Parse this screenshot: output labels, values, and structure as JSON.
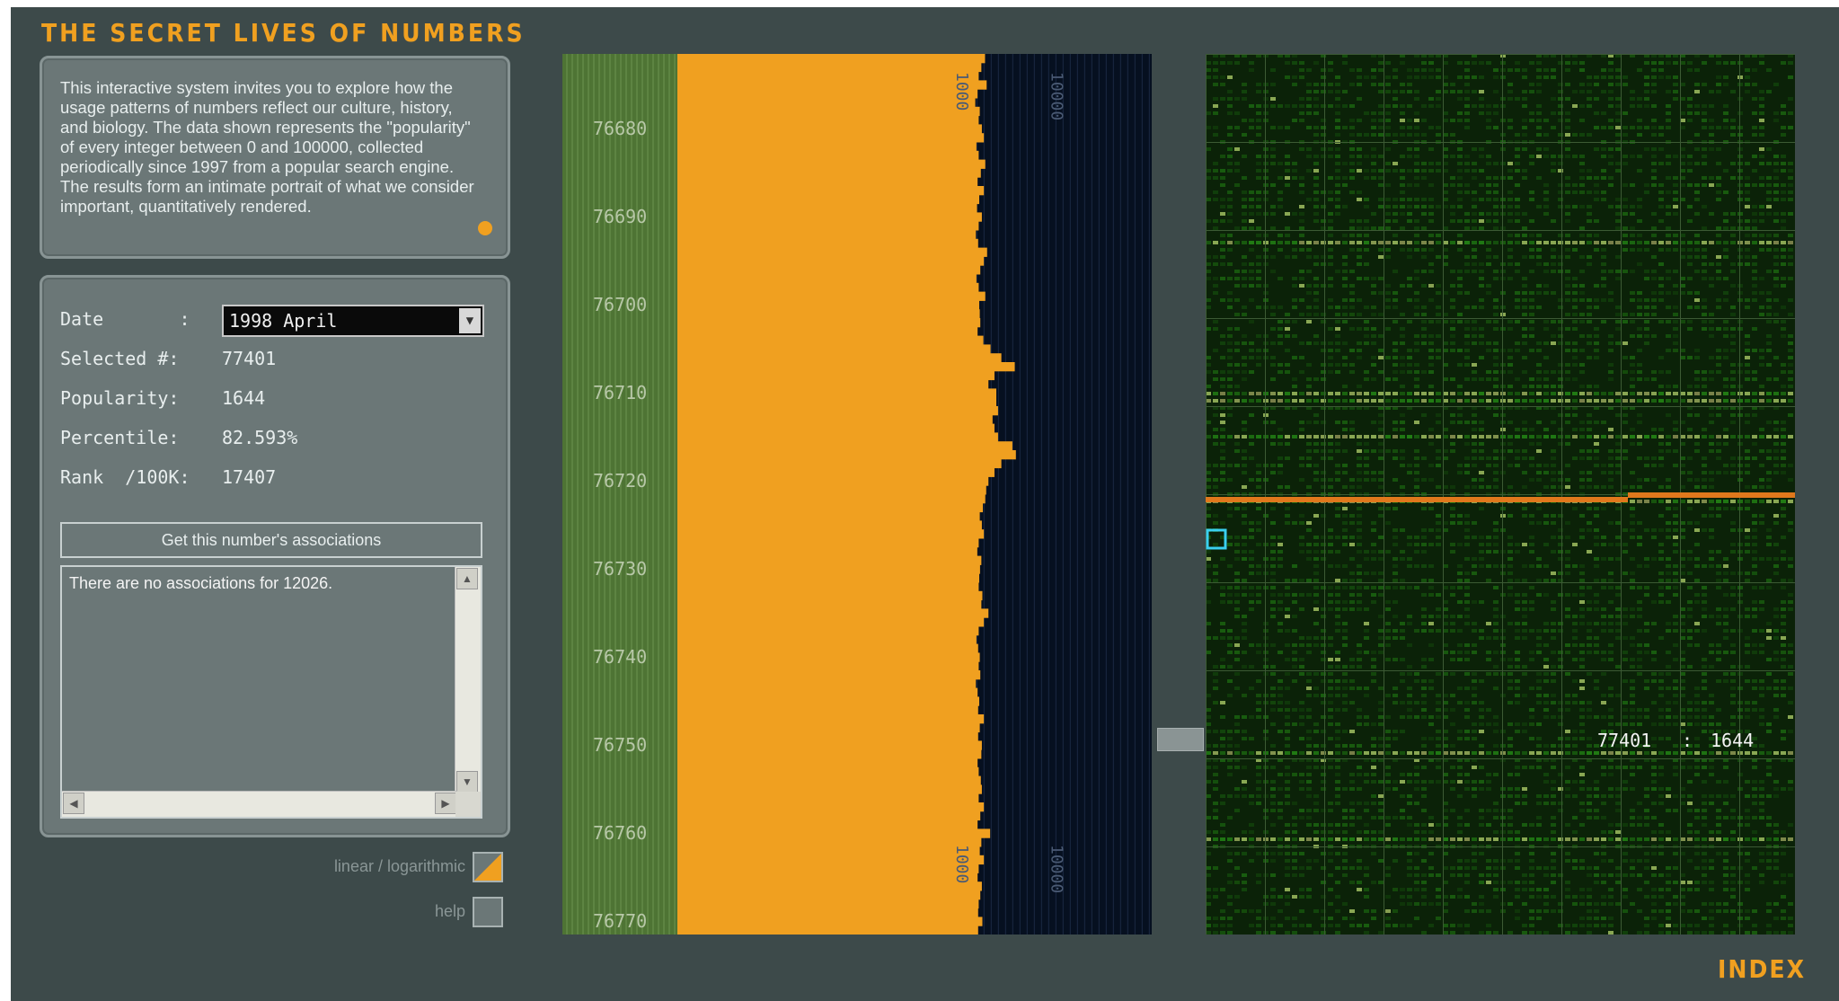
{
  "app": {
    "title": "THE SECRET LIVES OF NUMBERS",
    "index_label": "INDEX",
    "accent_color": "#f0a020"
  },
  "intro": {
    "text": "This interactive system invites you to explore how the usage patterns of numbers reflect our culture, history, and biology. The data shown represents the \"popularity\" of every integer between 0 and 100000, collected periodically since 1997 from a popular search engine. The results form an intimate portrait of what we consider important, quantitatively rendered."
  },
  "info": {
    "date_label": "Date       :",
    "date_value": "1998 April",
    "selected_label": "Selected #:",
    "selected_value": "77401",
    "popularity_label": "Popularity:",
    "popularity_value": "1644",
    "percentile_label": "Percentile:",
    "percentile_value": "82.593%",
    "rank_label": "Rank  /100K:",
    "rank_value": "17407",
    "assoc_button": "Get this number's associations",
    "assoc_text": "There are no associations for 12026."
  },
  "controls": {
    "lin_log_label": "linear / logarithmic",
    "help_label": "help"
  },
  "index_map": {
    "readout_number": "77401",
    "readout_sep": ":",
    "readout_value": "1644"
  },
  "chart_data": {
    "type": "bar",
    "orientation": "horizontal",
    "axis_scale": "log",
    "row_labels": [
      "76680",
      "76690",
      "76700",
      "76710",
      "76720",
      "76730",
      "76740",
      "76750",
      "76760",
      "76770"
    ],
    "scale_labels": [
      "1000",
      "10000"
    ],
    "bar_color": "#f0a020",
    "values": [
      1750,
      1600,
      1500,
      1820,
      1460,
      1380,
      1540,
      1500,
      1620,
      1700,
      1420,
      1500,
      1760,
      1580,
      1460,
      1700,
      1520,
      1440,
      1620,
      1500,
      1400,
      1480,
      1840,
      1700,
      1560,
      1420,
      1500,
      1760,
      1520,
      1540,
      1560,
      1460,
      1680,
      2000,
      2600,
      3600,
      2200,
      1900,
      2300,
      2300,
      2400,
      2100,
      2200,
      2400,
      3400,
      3700,
      2600,
      2200,
      1900,
      1800,
      1760,
      1660,
      1540,
      1620,
      1700,
      1500,
      1450,
      1600,
      1550,
      1520,
      1500,
      1640,
      1600,
      1900,
      1700,
      1500,
      1420,
      1480,
      1540,
      1500,
      1560,
      1400,
      1460,
      1520,
      1480,
      1700,
      1540,
      1480,
      1620,
      1600,
      1460,
      1500,
      1580,
      1620,
      1500,
      1700,
      1560,
      1460,
      1980,
      1600,
      1540,
      1700,
      1500,
      1460,
      1620,
      1560,
      1500,
      1480,
      1640,
      1480
    ]
  }
}
